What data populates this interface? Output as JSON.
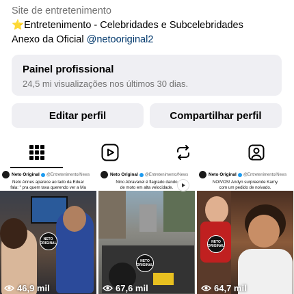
{
  "profile": {
    "category": "Site de entretenimento",
    "bio_line1_star": "⭐",
    "bio_line1_text": "Entretenimento - Celebridades e Subcelebridades",
    "bio_line2_text": "Anexo da Oficial ",
    "bio_line2_mention": "@netooriginal2"
  },
  "panel": {
    "title": "Painel profissional",
    "subtitle": "24,5 mi visualizações nos últimos 30 dias."
  },
  "buttons": {
    "edit": "Editar perfil",
    "share": "Compartilhar perfil"
  },
  "tabs": [
    {
      "icon": "grid-icon",
      "active": true
    },
    {
      "icon": "reels-icon",
      "active": false
    },
    {
      "icon": "reposts-icon",
      "active": false
    },
    {
      "icon": "tagged-icon",
      "active": false
    }
  ],
  "posts": [
    {
      "author": "Neto Original",
      "handle": "@Entretenimento/News",
      "caption": "Neto Annes aparece ao lado da Eduar",
      "caption2": "fala: \" pra quem tava querendo ver a Ma",
      "views": "46,9 mil",
      "watermark": "NETO ORIGINAL"
    },
    {
      "author": "Neto Original",
      "handle": "@Entretenimento/News",
      "caption": "Nino Abravanel é flagrado dando",
      "caption2": "de moto em alta velocidade.",
      "views": "67,6 mil",
      "watermark": "NETO ORIGINAL"
    },
    {
      "author": "Neto Original",
      "handle": "@Entretenimento/News",
      "caption": "NOIVOS! Andyn surpreende Kamy",
      "caption2": "com um pedido de noivado.",
      "views": "64,7 mil",
      "watermark": "NETO ORIGINAL"
    }
  ]
}
